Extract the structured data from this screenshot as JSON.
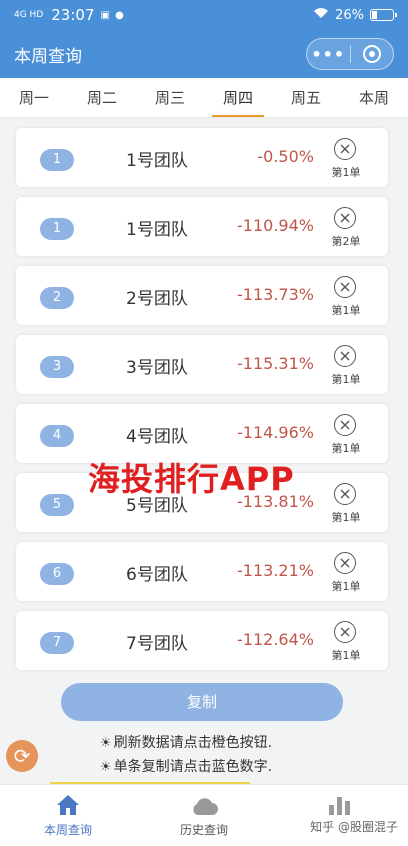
{
  "status_bar": {
    "signal": "4G HD",
    "time": "23:07",
    "battery": "26%",
    "battery_level": 0.26
  },
  "navbar": {
    "title": "本周查询",
    "more_icon": "•••"
  },
  "tabs": [
    {
      "label": "周一"
    },
    {
      "label": "周二"
    },
    {
      "label": "周三"
    },
    {
      "label": "周四"
    },
    {
      "label": "周五"
    },
    {
      "label": "本周"
    }
  ],
  "rows": [
    {
      "rank": "1",
      "team": "1号团队",
      "pct": "-0.50%",
      "order": "第1单"
    },
    {
      "rank": "1",
      "team": "1号团队",
      "pct": "-110.94%",
      "order": "第2单"
    },
    {
      "rank": "2",
      "team": "2号团队",
      "pct": "-113.73%",
      "order": "第1单"
    },
    {
      "rank": "3",
      "team": "3号团队",
      "pct": "-115.31%",
      "order": "第1单"
    },
    {
      "rank": "4",
      "team": "4号团队",
      "pct": "-114.96%",
      "order": "第1单"
    },
    {
      "rank": "5",
      "team": "5号团队",
      "pct": "-113.81%",
      "order": "第1单"
    },
    {
      "rank": "6",
      "team": "6号团队",
      "pct": "-113.21%",
      "order": "第1单"
    },
    {
      "rank": "7",
      "team": "7号团队",
      "pct": "-112.64%",
      "order": "第1单"
    }
  ],
  "watermark": "海投排行APP",
  "copy_button": "复制",
  "hints": [
    "刷新数据请点击橙色按钮.",
    "单条复制请点击蓝色数字."
  ],
  "bottom_nav": [
    {
      "label": "本周查询",
      "icon": "home-icon"
    },
    {
      "label": "历史查询",
      "icon": "cloud-icon"
    },
    {
      "label": "",
      "icon": "bar-chart-icon"
    }
  ],
  "corner_watermark": "知乎 @股圈混子",
  "colors": {
    "accent": "#4a90d9",
    "rank_badge": "#8fb3e3",
    "negative": "#c0564a",
    "tab_indicator": "#e89c2a",
    "refresh": "#e6945a"
  }
}
